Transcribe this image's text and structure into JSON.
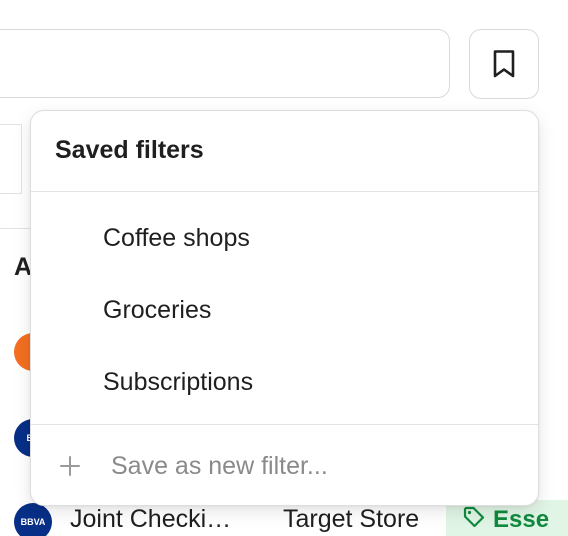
{
  "search": {
    "placeholder": ""
  },
  "toolbar": {
    "bookmark_icon": "bookmark-icon"
  },
  "background": {
    "column_header_partial": "A",
    "rows": [
      {
        "logo_text": "",
        "logo_color": "#f36f21"
      },
      {
        "logo_text": "BB",
        "logo_color": "#072f87"
      },
      {
        "logo_text": "BBVA",
        "logo_color": "#072f87",
        "account": "Joint Checki…",
        "merchant": "Target Store",
        "category": "Esse"
      }
    ]
  },
  "saved_filters": {
    "title": "Saved filters",
    "items": [
      {
        "label": "Coffee shops"
      },
      {
        "label": "Groceries"
      },
      {
        "label": "Subscriptions"
      }
    ],
    "save_new_label": "Save as new filter..."
  },
  "colors": {
    "border": "#d9d9d9",
    "text": "#1f1f1f",
    "muted": "#8a8a8a",
    "chip_bg": "#e1f5e6",
    "chip_text": "#0f8a3e",
    "bbva_navy": "#072f87",
    "orange": "#f36f21"
  }
}
